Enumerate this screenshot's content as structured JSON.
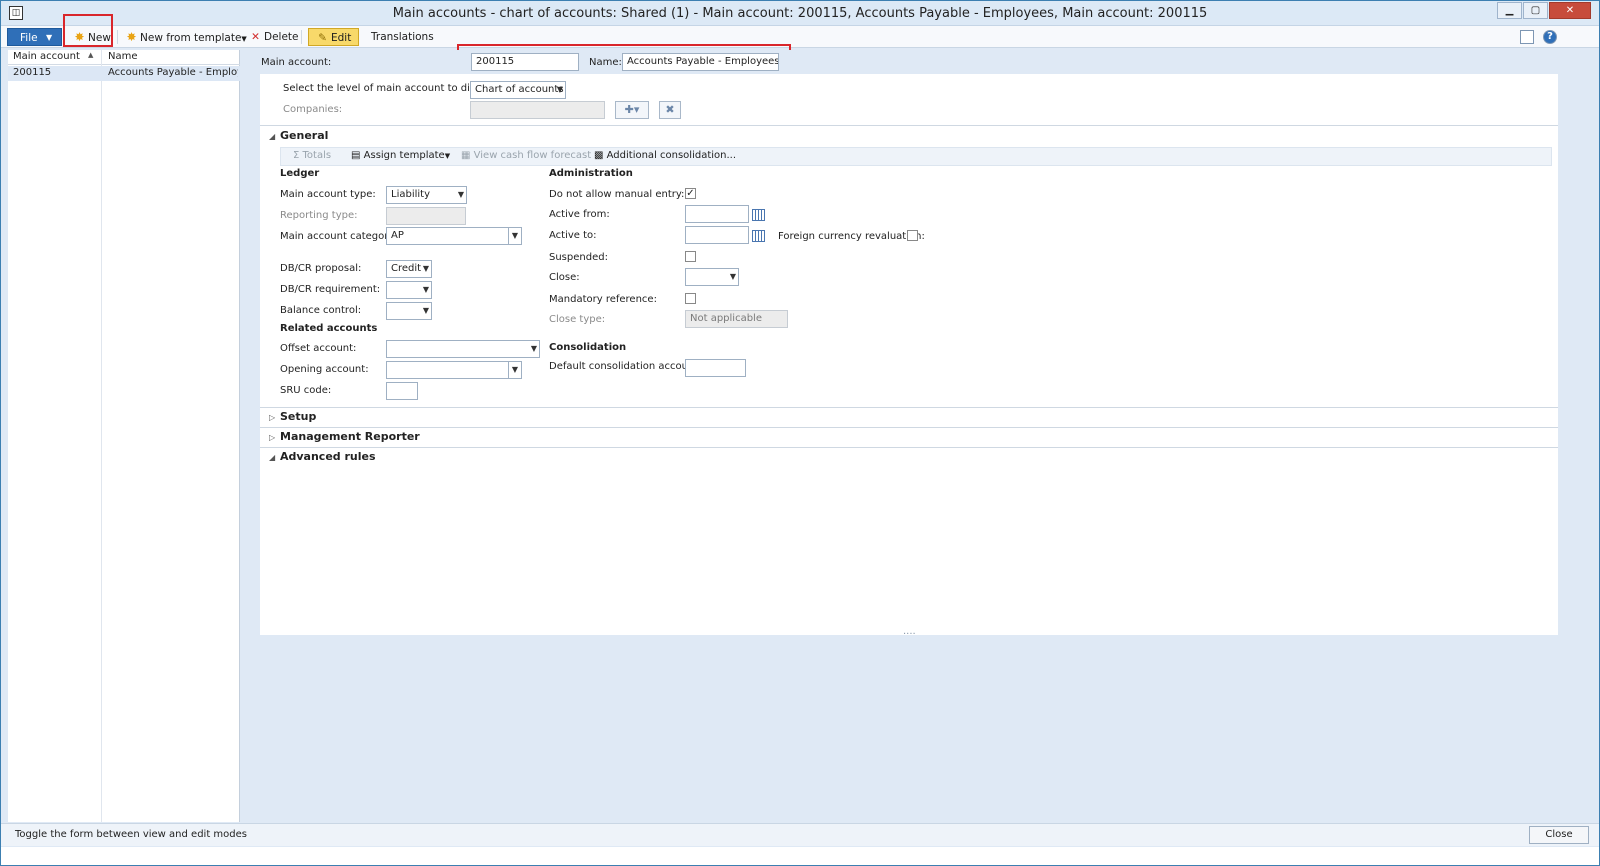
{
  "window": {
    "title": "Main accounts - chart of accounts: Shared (1) - Main account: 200115, Accounts Payable - Employees, Main account: 200115",
    "app_icon_glyph": "◫"
  },
  "toolbar": {
    "file_label": "File",
    "new_label": "New",
    "new_from_template_label": "New from template",
    "delete_label": "Delete",
    "edit_label": "Edit",
    "translations_label": "Translations"
  },
  "list": {
    "col_main_account": "Main account",
    "col_name": "Name",
    "rows": [
      {
        "main_account": "200115",
        "name": "Accounts Payable - Employees"
      }
    ]
  },
  "header": {
    "main_account_label": "Main account:",
    "main_account_value": "200115",
    "name_label": "Name:",
    "name_value": "Accounts Payable - Employees",
    "level_label": "Select the level of main account to display:",
    "level_value": "Chart of accounts",
    "companies_label": "Companies:",
    "companies_value": ""
  },
  "general": {
    "title": "General",
    "subtoolbar": {
      "totals": "Totals",
      "assign_template": "Assign template",
      "view_cash_flow": "View cash flow forecast",
      "additional_consolidation": "Additional consolidation..."
    },
    "ledger": {
      "title": "Ledger",
      "main_account_type_label": "Main account type:",
      "main_account_type_value": "Liability",
      "reporting_type_label": "Reporting type:",
      "reporting_type_value": "",
      "main_account_category_label": "Main account category:",
      "main_account_category_value": "AP",
      "dbcr_proposal_label": "DB/CR proposal:",
      "dbcr_proposal_value": "Credit",
      "dbcr_requirement_label": "DB/CR requirement:",
      "dbcr_requirement_value": "",
      "balance_control_label": "Balance control:",
      "balance_control_value": ""
    },
    "related": {
      "title": "Related accounts",
      "offset_account_label": "Offset account:",
      "offset_account_value": "",
      "opening_account_label": "Opening account:",
      "opening_account_value": "",
      "sru_code_label": "SRU code:",
      "sru_code_value": ""
    },
    "administration": {
      "title": "Administration",
      "no_manual_entry_label": "Do not allow manual entry:",
      "no_manual_entry_checked": true,
      "active_from_label": "Active from:",
      "active_from_value": "",
      "active_to_label": "Active to:",
      "active_to_value": "",
      "foreign_currency_label": "Foreign currency revaluation:",
      "suspended_label": "Suspended:",
      "close_label": "Close:",
      "close_value": "",
      "mandatory_reference_label": "Mandatory reference:",
      "close_type_label": "Close type:",
      "close_type_value": "Not applicable"
    },
    "consolidation": {
      "title": "Consolidation",
      "default_account_label": "Default consolidation account:",
      "default_account_value": ""
    }
  },
  "sections": {
    "setup": "Setup",
    "management_reporter": "Management Reporter",
    "advanced_rules": "Advanced rules"
  },
  "status": {
    "text": "Toggle the form between view and edit modes",
    "close_label": "Close"
  },
  "colors": {
    "accent": "#2f6fb8",
    "highlight_box": "#d9262b",
    "edit_button": "#f8d96a"
  }
}
